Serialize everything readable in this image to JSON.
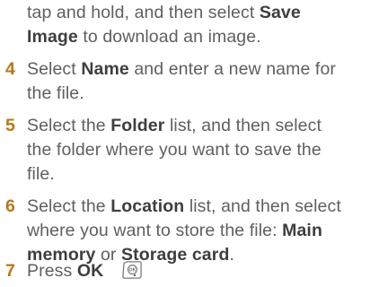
{
  "steps": {
    "prev": {
      "line1": {
        "t1": "tap and hold, and then select ",
        "b1": "Save"
      },
      "line2": {
        "b1": "Image",
        "t1": " to download an image."
      }
    },
    "s4": {
      "num": "4",
      "line1": {
        "t1": "Select ",
        "b1": "Name",
        "t2": " and enter a new name for"
      },
      "line2": {
        "t1": "the file."
      }
    },
    "s5": {
      "num": "5",
      "line1": {
        "t1": "Select the ",
        "b1": "Folder",
        "t2": " list, and then select"
      },
      "line2": {
        "t1": "the folder where you want to save the"
      },
      "line3": {
        "t1": "file."
      }
    },
    "s6": {
      "num": "6",
      "line1": {
        "t1": "Select the ",
        "b1": "Location",
        "t2": " list, and then select"
      },
      "line2": {
        "t1": "where you want to store the file: ",
        "b1": "Main"
      },
      "line3": {
        "b1": "memory",
        "t1": " or ",
        "b2": "Storage card",
        "t2": "."
      }
    },
    "s7": {
      "num": "7",
      "line1": {
        "t1": "Press ",
        "b1": "OK",
        "t2": "."
      },
      "ok_icon": "ok-key-icon"
    }
  }
}
